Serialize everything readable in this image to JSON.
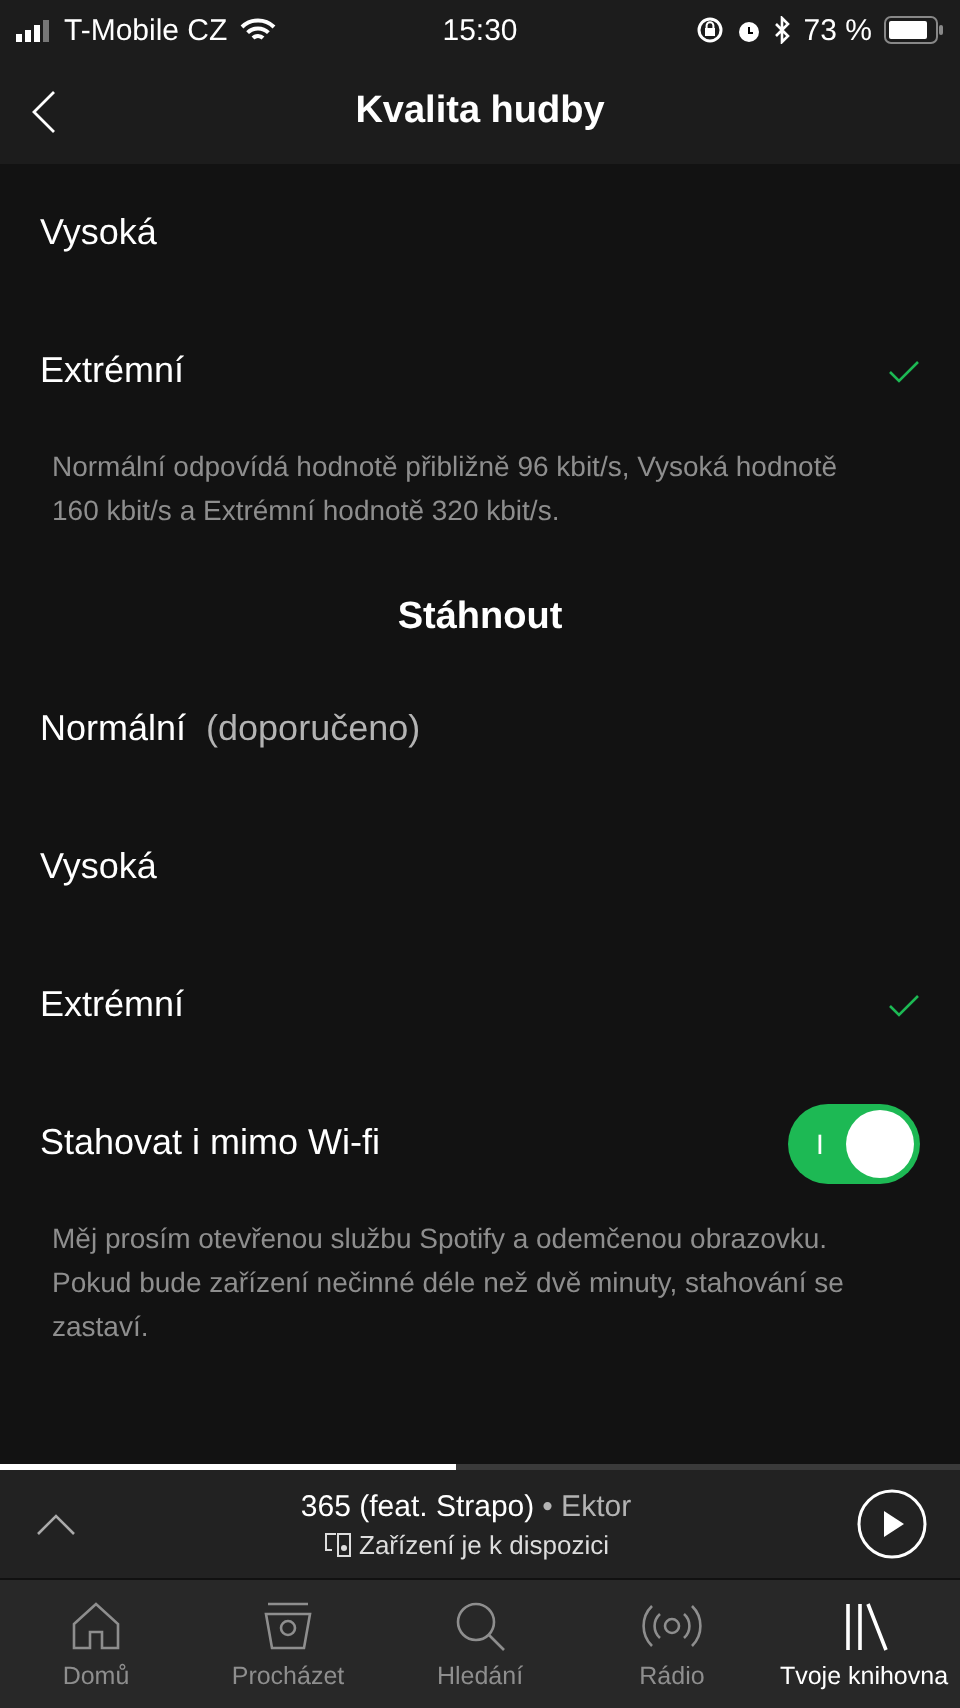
{
  "status_bar": {
    "carrier": "T-Mobile CZ",
    "time": "15:30",
    "battery": "73 %"
  },
  "header": {
    "title": "Kvalita hudby"
  },
  "streaming": {
    "options": [
      {
        "label": "Vysoká",
        "selected": false
      },
      {
        "label": "Extrémní",
        "selected": true
      }
    ],
    "note": "Normální odpovídá hodnotě přibližně 96 kbit/s, Vysoká hodnotě 160 kbit/s a Extrémní hodnotě 320 kbit/s."
  },
  "download": {
    "title": "Stáhnout",
    "options": [
      {
        "label": "Normální",
        "hint": "(doporučeno)",
        "selected": false
      },
      {
        "label": "Vysoká",
        "selected": false
      },
      {
        "label": "Extrémní",
        "selected": true
      }
    ],
    "toggle": {
      "label": "Stahovat i mimo Wi-fi",
      "on": true,
      "on_label": "I"
    },
    "note": "Měj prosím otevřenou službu Spotify a odemčenou obrazovku. Pokud bude zařízení nečinné déle než dvě minuty, stahování se zastaví."
  },
  "now_playing": {
    "title": "365 (feat. Strapo)",
    "separator": "•",
    "artist": "Ektor",
    "device": "Zařízení je k dispozici",
    "level": 0.475
  },
  "tabs": [
    {
      "label": "Domů",
      "selected": false
    },
    {
      "label": "Procházet",
      "selected": false
    },
    {
      "label": "Hledání",
      "selected": false
    },
    {
      "label": "Rádio",
      "selected": false
    },
    {
      "label": "Tvoje knihovna",
      "selected": true
    }
  ]
}
